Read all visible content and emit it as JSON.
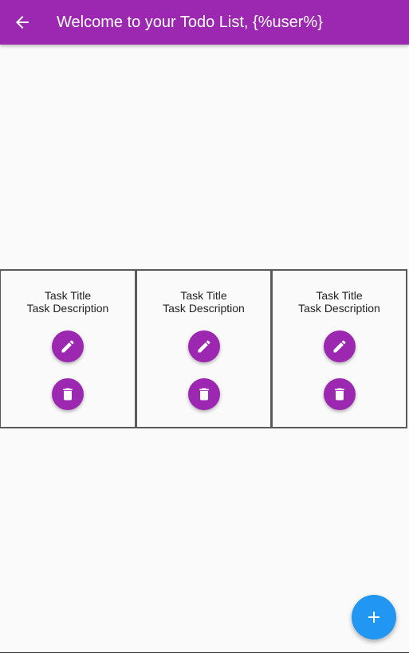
{
  "appbar": {
    "title": "Welcome to your Todo List, {%user%}",
    "back_icon": "arrow-back-icon",
    "color": "#9c27b0"
  },
  "tasks": [
    {
      "title": "Task Title",
      "description": "Task Description",
      "edit_icon": "pencil-icon",
      "delete_icon": "trash-icon"
    },
    {
      "title": "Task Title",
      "description": "Task Description",
      "edit_icon": "pencil-icon",
      "delete_icon": "trash-icon"
    },
    {
      "title": "Task Title",
      "description": "Task Description",
      "edit_icon": "pencil-icon",
      "delete_icon": "trash-icon"
    }
  ],
  "fab": {
    "icon": "plus-icon",
    "color": "#2196f3"
  },
  "accent_color": "#9c27b0"
}
